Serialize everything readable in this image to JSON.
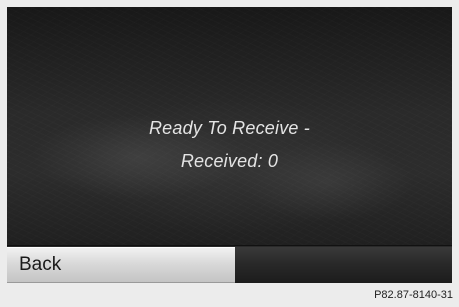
{
  "status": {
    "line1": "Ready To Receive -",
    "line2": "Received: 0"
  },
  "softkeys": {
    "back_label": "Back"
  },
  "figure_code": "P82.87-8140-31"
}
